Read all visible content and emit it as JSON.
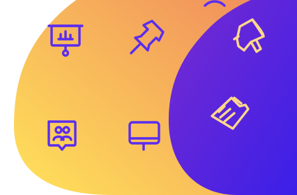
{
  "colors": {
    "background": "#ffffff",
    "gradient_warm_start": "#ffe35a",
    "gradient_warm_end": "#f08a5c",
    "gradient_cool_start": "#7a2bd0",
    "gradient_cool_end": "#3a1fe8",
    "icon_on_warm": "#5a2cf0",
    "icon_on_cool": "#ffd88a"
  },
  "icons": [
    "presentation-board-icon",
    "pushpin-icon",
    "megaphone-icon",
    "group-chat-icon",
    "monitor-icon",
    "document-icon"
  ]
}
